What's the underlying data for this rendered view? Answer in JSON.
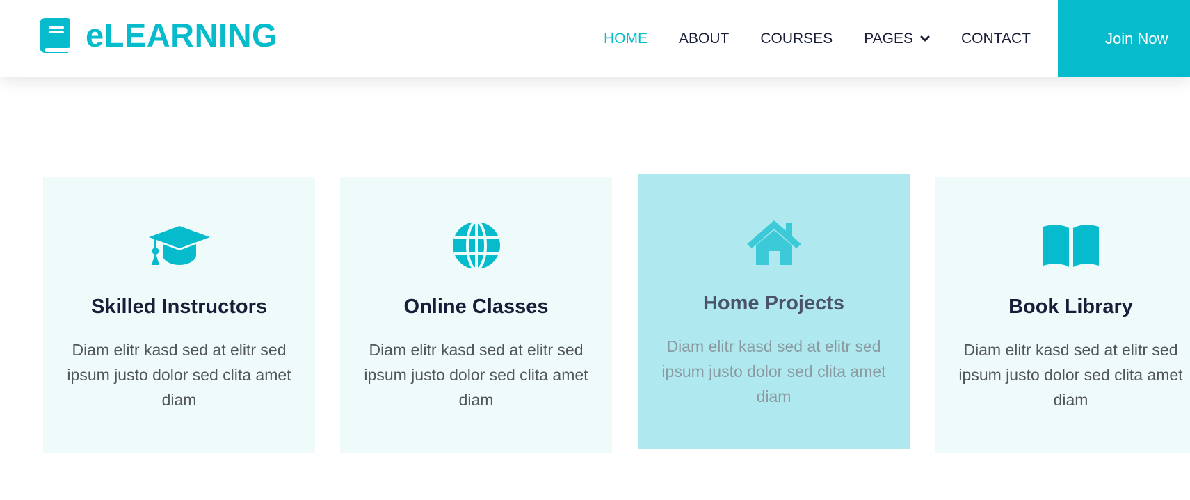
{
  "brand": {
    "name": "eLEARNING",
    "icon": "book-icon",
    "color": "#06BBCC"
  },
  "nav": {
    "items": [
      {
        "label": "HOME",
        "active": true
      },
      {
        "label": "ABOUT",
        "active": false
      },
      {
        "label": "COURSES",
        "active": false
      },
      {
        "label": "PAGES",
        "active": false,
        "dropdown": true
      },
      {
        "label": "CONTACT",
        "active": false
      }
    ],
    "join_label": "Join Now"
  },
  "services": [
    {
      "icon": "graduation-cap-icon",
      "title": "Skilled Instructors",
      "text": "Diam elitr kasd sed at elitr sed ipsum justo dolor sed clita amet diam"
    },
    {
      "icon": "globe-icon",
      "title": "Online Classes",
      "text": "Diam elitr kasd sed at elitr sed ipsum justo dolor sed clita amet diam"
    },
    {
      "icon": "home-icon",
      "title": "Home Projects",
      "text": "Diam elitr kasd sed at elitr sed ipsum justo dolor sed clita amet diam",
      "highlighted": true
    },
    {
      "icon": "book-open-icon",
      "title": "Book Library",
      "text": "Diam elitr kasd sed at elitr sed ipsum justo dolor sed clita amet diam"
    }
  ],
  "colors": {
    "primary": "#06BBCC",
    "dark": "#181d38",
    "card_bg": "#EFFAFB",
    "card_highlight_bg": "#AFE9EF"
  }
}
